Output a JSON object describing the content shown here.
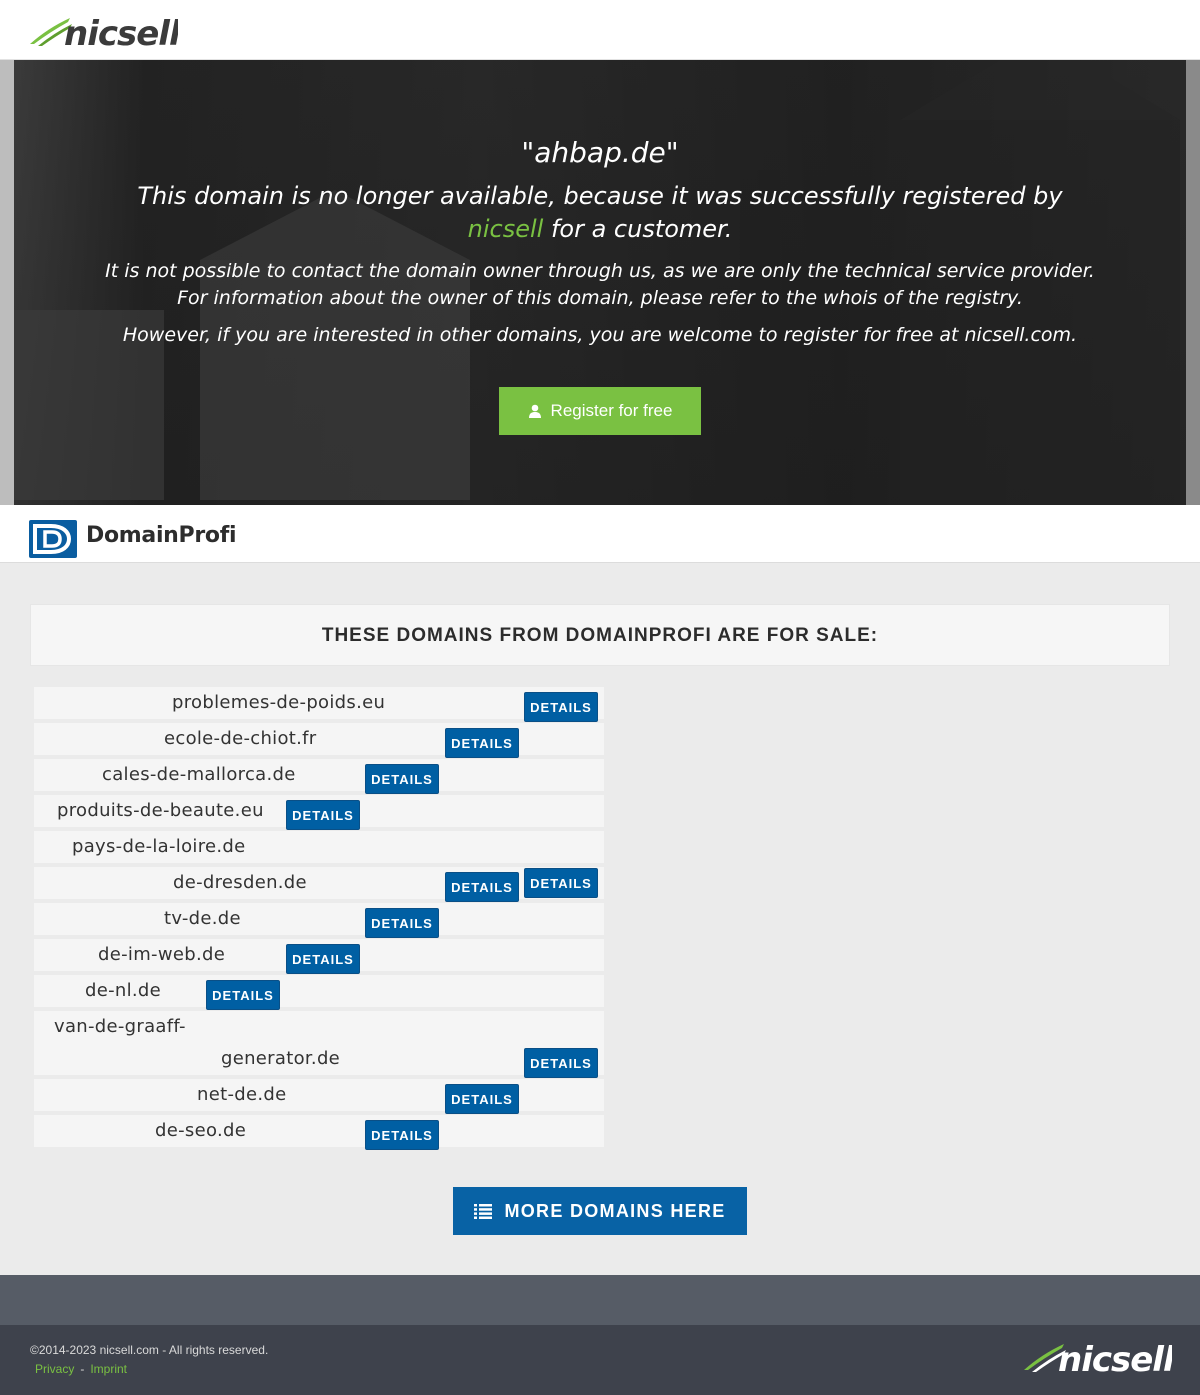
{
  "header": {
    "brand": "nicsell"
  },
  "hero": {
    "domain": "\"ahbap.de\"",
    "title_before": "This domain is no longer available, because it was successfully registered by ",
    "title_brand": "nicsell",
    "title_after": " for a customer.",
    "info": "It is not possible to contact the domain owner through us, as we are only the technical service provider. For information about the owner of this domain, please refer to the whois of the registry.",
    "interest": "However, if you are interested in other domains, you are welcome to register for free at nicsell.com.",
    "register_label": "Register for free",
    "register_icon": "user-icon"
  },
  "domainprofi": {
    "brand": "DomainProfi"
  },
  "sale": {
    "title": "THESE DOMAINS FROM DOMAINPROFI ARE FOR SALE:",
    "details_label": "DETAILS",
    "domains": [
      {
        "name": "problemes-de-poids.eu"
      },
      {
        "name": "ecole-de-chiot.fr"
      },
      {
        "name": "cales-de-mallorca.de"
      },
      {
        "name": "produits-de-beaute.eu"
      },
      {
        "name": "pays-de-la-loire.de"
      },
      {
        "name": "de-dresden.de"
      },
      {
        "name": "tv-de.de"
      },
      {
        "name": "de-im-web.de"
      },
      {
        "name": "de-nl.de"
      },
      {
        "name": "van-de-graaff-generator.de",
        "line1": "van-de-graaff-",
        "line2": "generator.de"
      },
      {
        "name": "net-de.de"
      },
      {
        "name": "de-seo.de"
      }
    ]
  },
  "more": {
    "label": "MORE DOMAINS HERE",
    "icon": "list-icon"
  },
  "footer": {
    "copyright": "©2014-2023 nicsell.com - All rights reserved.",
    "privacy": "Privacy",
    "separator": "-",
    "imprint": "Imprint",
    "brand": "nicsell"
  },
  "colors": {
    "accent_green": "#7ac142",
    "button_blue": "#005fa3",
    "footer_dark": "#3e424c"
  }
}
